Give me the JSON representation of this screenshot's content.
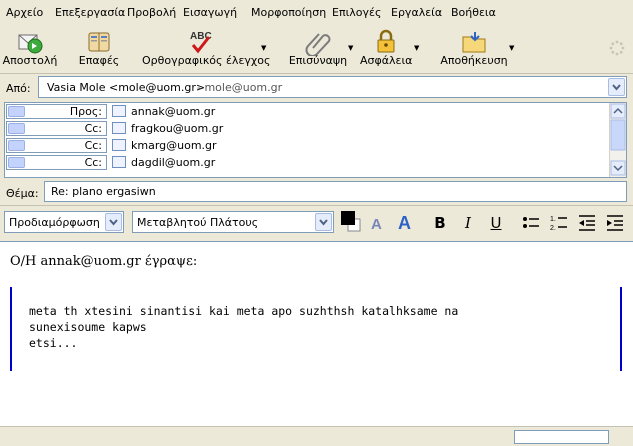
{
  "menu": [
    "Αρχείο",
    "Επεξεργασία",
    "Προβολή",
    "Εισαγωγή",
    "Μορφοποίηση",
    "Επιλογές",
    "Εργαλεία",
    "Βοήθεια"
  ],
  "toolbar": {
    "send": "Αποστολή",
    "contacts": "Επαφές",
    "spell": "Ορθογραφικός έλεγχος",
    "spell_badge": "ABC",
    "attach": "Επισύναψη",
    "security": "Ασφάλεια",
    "save": "Αποθήκευση"
  },
  "from": {
    "label": "Από:",
    "name": "Vasia Mole <mole@uom.gr>",
    "account": "- mole@uom.gr"
  },
  "recipients": [
    {
      "type": "Προς:",
      "address": "annak@uom.gr"
    },
    {
      "type": "Cc:",
      "address": "fragkou@uom.gr"
    },
    {
      "type": "Cc:",
      "address": "kmarg@uom.gr"
    },
    {
      "type": "Cc:",
      "address": "dagdil@uom.gr"
    }
  ],
  "subject": {
    "label": "Θέμα:",
    "value": "Re: plano ergasiwn"
  },
  "format": {
    "paragraph_style": "Προδιαμόρφωση",
    "font": "Μεταβλητού Πλάτους",
    "bold": "B",
    "italic": "I",
    "underline": "U",
    "text_color": "#000000"
  },
  "message": {
    "attribution": "Ο/Η annak@uom.gr έγραψε:",
    "quote_lines": [
      "meta th xtesini sinantisi kai meta apo suzhthsh katalhksame na",
      "sunexisoume kapws",
      "etsi..."
    ]
  },
  "colors": {
    "quote_bar": "#0000cc",
    "field_border": "#7f9db9"
  }
}
